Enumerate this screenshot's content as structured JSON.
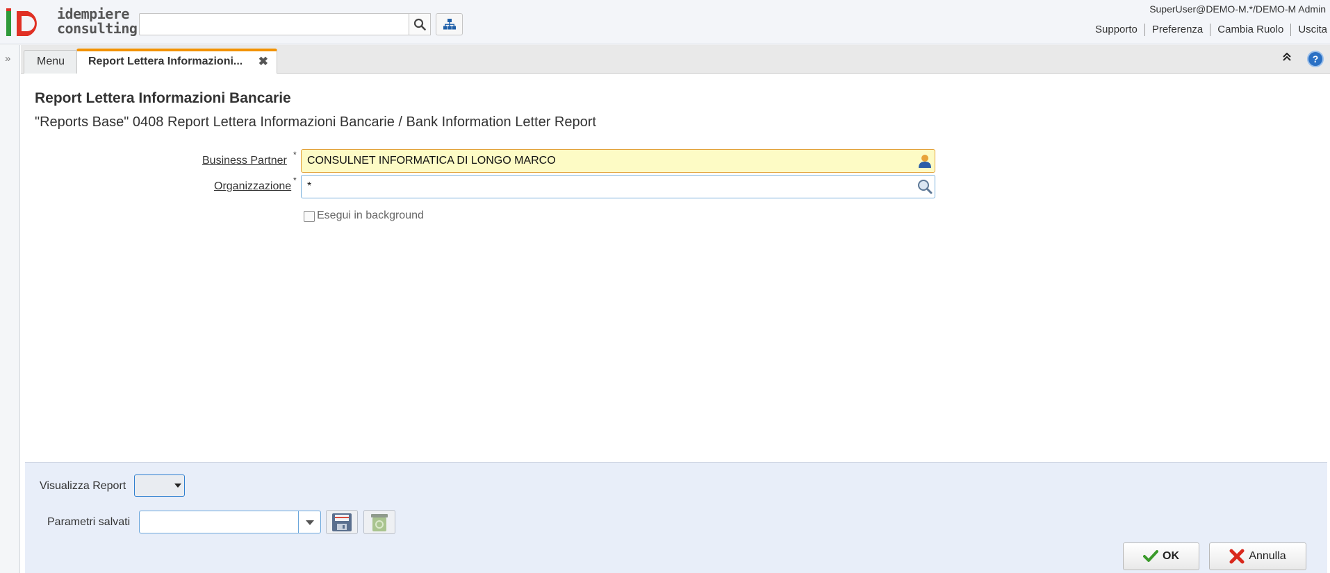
{
  "header": {
    "logo_line1": "idempiere",
    "logo_line2": "consulting",
    "search_placeholder": "",
    "user": "SuperUser@DEMO-M.*/DEMO-M Admin",
    "links": [
      "Supporto",
      "Preferenza",
      "Cambia Ruolo",
      "Uscita"
    ]
  },
  "tabs": {
    "menu_label": "Menu",
    "active_label": "Report Lettera Informazioni..."
  },
  "form": {
    "title": "Report Lettera Informazioni Bancarie",
    "subtitle": "\"Reports Base\" 0408 Report Lettera Informazioni Bancarie / Bank Information Letter Report",
    "business_partner_label": "Business Partner",
    "business_partner_value": "CONSULNET INFORMATICA DI LONGO MARCO",
    "organization_label": "Organizzazione",
    "organization_value": "*",
    "required_mark": "*",
    "background_label": "Esegui in background",
    "background_checked": false
  },
  "bottom": {
    "view_report_label": "Visualizza Report",
    "view_report_value": "",
    "saved_params_label": "Parametri salvati",
    "saved_params_value": "",
    "ok_label": "OK",
    "cancel_label": "Annulla"
  },
  "colors": {
    "tab_accent": "#f29200",
    "mandatory_bg": "#fdfbc5",
    "panel_bg": "#e8eef9",
    "ok_check": "#3a9a2a",
    "cancel_x": "#d9281c"
  }
}
